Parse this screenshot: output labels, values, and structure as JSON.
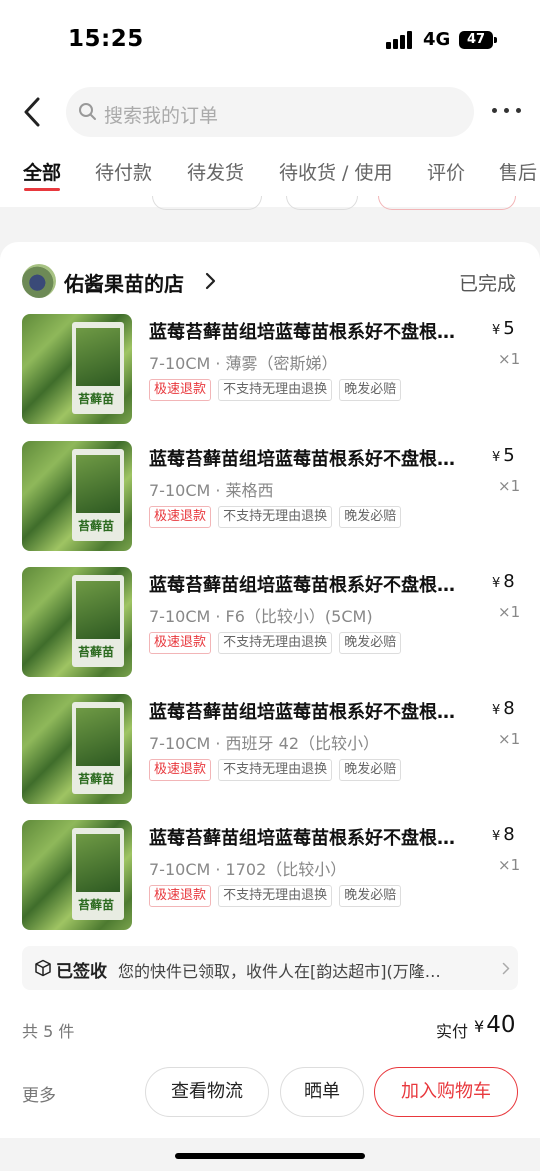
{
  "status_bar": {
    "time": "15:25",
    "network": "4G",
    "battery": "47"
  },
  "search": {
    "placeholder": "搜索我的订单"
  },
  "tabs": [
    {
      "label": "全部",
      "active": true
    },
    {
      "label": "待付款"
    },
    {
      "label": "待发货"
    },
    {
      "label": "待收货 / 使用"
    },
    {
      "label": "评价"
    },
    {
      "label": "售后"
    }
  ],
  "order": {
    "store_name": "佑酱果苗的店",
    "status": "已完成",
    "items": [
      {
        "title": "蓝莓苔藓苗组培蓝莓苗根系好不盘根…",
        "spec": "7-10CM · 薄雾（密斯娣）",
        "price_symbol": "¥",
        "price": "5",
        "qty": "×1",
        "thumb_label": "苔藓苗",
        "tags": [
          "极速退款",
          "不支持无理由退换",
          "晚发必赔"
        ]
      },
      {
        "title": "蓝莓苔藓苗组培蓝莓苗根系好不盘根…",
        "spec": "7-10CM · 莱格西",
        "price_symbol": "¥",
        "price": "5",
        "qty": "×1",
        "thumb_label": "苔藓苗",
        "tags": [
          "极速退款",
          "不支持无理由退换",
          "晚发必赔"
        ]
      },
      {
        "title": "蓝莓苔藓苗组培蓝莓苗根系好不盘根…",
        "spec": "7-10CM · F6（比较小）(5CM)",
        "price_symbol": "¥",
        "price": "8",
        "qty": "×1",
        "thumb_label": "苔藓苗",
        "tags": [
          "极速退款",
          "不支持无理由退换",
          "晚发必赔"
        ]
      },
      {
        "title": "蓝莓苔藓苗组培蓝莓苗根系好不盘根…",
        "spec": "7-10CM · 西班牙 42（比较小）",
        "price_symbol": "¥",
        "price": "8",
        "qty": "×1",
        "thumb_label": "苔藓苗",
        "tags": [
          "极速退款",
          "不支持无理由退换",
          "晚发必赔"
        ]
      },
      {
        "title": "蓝莓苔藓苗组培蓝莓苗根系好不盘根…",
        "spec": "7-10CM · 1702（比较小）",
        "price_symbol": "¥",
        "price": "8",
        "qty": "×1",
        "thumb_label": "苔藓苗",
        "tags": [
          "极速退款",
          "不支持无理由退换",
          "晚发必赔"
        ]
      }
    ],
    "logistics": {
      "status": "已签收",
      "text": "您的快件已领取，收件人在[韵达超市](万隆…"
    },
    "count_text": "共 5 件",
    "paid_label": "实付",
    "paid_symbol": "¥",
    "paid_amount": "40",
    "actions": {
      "more": "更多",
      "view_logistics": "查看物流",
      "share": "晒单",
      "add_to_cart": "加入购物车"
    }
  },
  "colors": {
    "accent": "#e8383d",
    "background": "#f3f3f3"
  }
}
